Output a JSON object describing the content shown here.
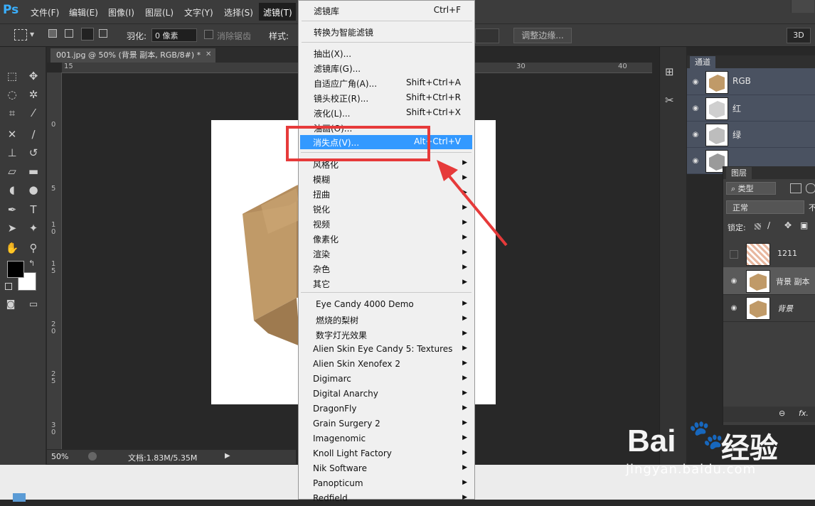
{
  "app": {
    "logo": "Ps"
  },
  "menubar": {
    "items": [
      "文件(F)",
      "编辑(E)",
      "图像(I)",
      "图层(L)",
      "文字(Y)",
      "选择(S)",
      "滤镜(T)"
    ]
  },
  "options": {
    "feather_label": "羽化:",
    "feather_value": "0 像素",
    "antialias_label": "消除锯齿",
    "style_label": "样式:",
    "refine_edge": "调整边缘...",
    "threed": "3D"
  },
  "document": {
    "tab_title": "001.jpg @ 50% (背景 副本, RGB/8#) *",
    "ruler_top": [
      "15",
      "30",
      "40"
    ],
    "ruler_left": [
      "0",
      "5",
      "1 0",
      "1 5",
      "2 0",
      "2 5",
      "3 0"
    ],
    "zoom": "50%",
    "doc_info": "文档:1.83M/5.35M"
  },
  "channels": {
    "tab": "通道",
    "rows": [
      {
        "name": "RGB"
      },
      {
        "name": "红"
      },
      {
        "name": "绿"
      },
      {
        "name": ""
      }
    ]
  },
  "layers": {
    "tab": "图层",
    "filter_kind": "类型",
    "blend_mode": "正常",
    "opacity_cut": "不",
    "lock_label": "锁定:",
    "rows": [
      {
        "name": "1211"
      },
      {
        "name": "背景 副本"
      },
      {
        "name": "背景"
      }
    ],
    "fx": "fx."
  },
  "filter_menu": {
    "top": [
      {
        "label": "滤镜库",
        "shortcut": "Ctrl+F"
      }
    ],
    "convert": "转换为智能滤镜",
    "main": [
      {
        "label": "抽出(X)...",
        "shortcut": ""
      },
      {
        "label": "滤镜库(G)...",
        "shortcut": ""
      },
      {
        "label": "自适应广角(A)...",
        "shortcut": "Shift+Ctrl+A"
      },
      {
        "label": "镜头校正(R)...",
        "shortcut": "Shift+Ctrl+R"
      },
      {
        "label": "液化(L)...",
        "shortcut": "Shift+Ctrl+X"
      },
      {
        "label": "油画(O)...",
        "shortcut": ""
      },
      {
        "label": "消失点(V)...",
        "shortcut": "Alt+Ctrl+V"
      }
    ],
    "submenus": [
      "风格化",
      "模糊",
      "扭曲",
      "锐化",
      "视频",
      "像素化",
      "渲染",
      "杂色",
      "其它"
    ],
    "plugins": [
      "Eye Candy 4000  Demo",
      "燃烧的梨树",
      "数字灯光效果",
      "Alien Skin Eye Candy 5: Textures",
      "Alien Skin Xenofex 2",
      "Digimarc",
      "Digital Anarchy",
      "DragonFly",
      "Grain Surgery 2",
      "Imagenomic",
      "Knoll Light Factory",
      "Nik Software",
      "Panopticum",
      "Redfield"
    ]
  },
  "watermark": {
    "brand": "Bai",
    "brand_cn": "经验",
    "url": "jingyan.baidu.com"
  },
  "colors": {
    "highlight": "#3399ff",
    "annotation": "#e63a3a",
    "ps_blue": "#3ab0ff"
  }
}
